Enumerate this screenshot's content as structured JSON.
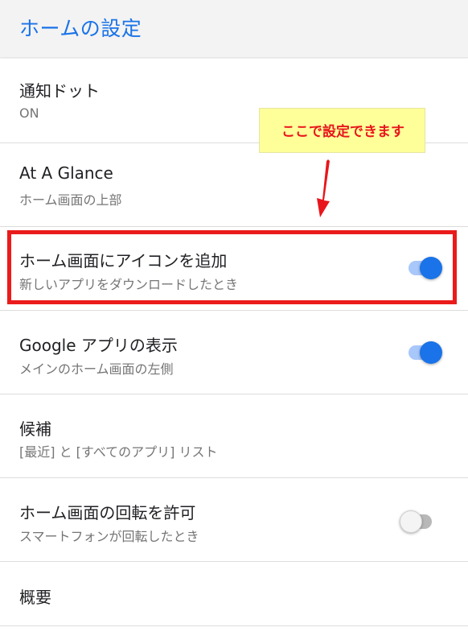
{
  "header": {
    "title": "ホームの設定"
  },
  "settings": [
    {
      "title": "通知ドット",
      "subtitle": "ON"
    },
    {
      "title": "At A Glance",
      "subtitle": "ホーム画面の上部"
    },
    {
      "title": "ホーム画面にアイコンを追加",
      "subtitle": "新しいアプリをダウンロードしたとき",
      "toggle": "on"
    },
    {
      "title": "Google アプリの表示",
      "subtitle": "メインのホーム画面の左側",
      "toggle": "on"
    },
    {
      "title": "候補",
      "subtitle": "[最近] と [すべてのアプリ] リスト"
    },
    {
      "title": "ホーム画面の回転を許可",
      "subtitle": "スマートフォンが回転したとき",
      "toggle": "off"
    },
    {
      "title": "概要"
    }
  ],
  "annotation": {
    "callout_text": "ここで設定できます"
  },
  "colors": {
    "accent": "#1a73e8",
    "highlight_border": "#ea1b1b",
    "callout_background": "#ffff99",
    "callout_text": "#e8161c"
  }
}
